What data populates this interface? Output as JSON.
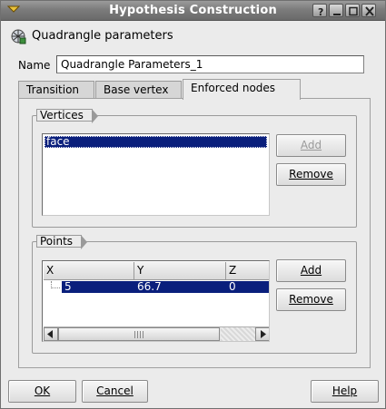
{
  "window": {
    "title": "Hypothesis Construction",
    "controls": [
      "help-icon",
      "minimize-icon",
      "maximize-icon",
      "close-icon"
    ]
  },
  "header": {
    "label": "Quadrangle parameters"
  },
  "name_field": {
    "label": "Name",
    "value": "Quadrangle Parameters_1"
  },
  "tabs": [
    {
      "label": "Transition",
      "active": false
    },
    {
      "label": "Base vertex",
      "active": false
    },
    {
      "label": "Enforced nodes",
      "active": true
    }
  ],
  "vertices": {
    "title": "Vertices",
    "items": [
      "face"
    ],
    "add_label": "Add",
    "remove_label": "Remove"
  },
  "points": {
    "title": "Points",
    "columns": [
      "X",
      "Y",
      "Z"
    ],
    "rows": [
      {
        "x": "5",
        "y": "66.7",
        "z": "0"
      }
    ],
    "add_label": "Add",
    "remove_label": "Remove"
  },
  "footer": {
    "ok_label": "OK",
    "cancel_label": "Cancel",
    "help_label": "Help"
  },
  "colors": {
    "selection": "#0a1f7c",
    "titlebar": "#7c7c7c"
  }
}
